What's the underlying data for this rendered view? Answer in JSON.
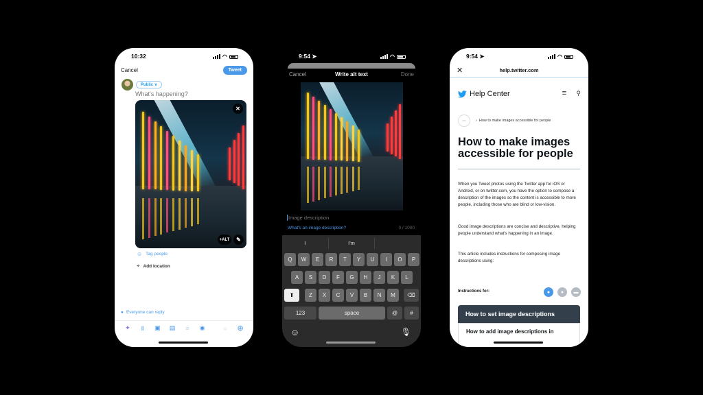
{
  "compose_screen": {
    "time": "10:32",
    "cancel_label": "Cancel",
    "tweet_label": "Tweet",
    "audience_label": "Public",
    "placeholder": "What's happening?",
    "image_close_icon": "close-icon",
    "alt_button_label": "+ALT",
    "edit_icon": "pencil-icon",
    "tag_people_label": "Tag people",
    "add_location_label": "Add location",
    "reply_setting_label": "Everyone can reply",
    "toolbar_icons": [
      "spaces-icon",
      "audio-icon",
      "image-icon",
      "gif-icon",
      "poll-icon",
      "location-icon"
    ],
    "accent_color": "#4a99e9"
  },
  "alt_text_screen": {
    "time": "9:54",
    "cancel_label": "Cancel",
    "title": "Write alt text",
    "done_label": "Done",
    "input_placeholder": "Image description",
    "help_link": "What's an image description?",
    "char_count": "0 / 1000",
    "suggestions": [
      "I",
      "I'm",
      ""
    ],
    "keyboard_rows": [
      [
        "Q",
        "W",
        "E",
        "R",
        "T",
        "Y",
        "U",
        "I",
        "O",
        "P"
      ],
      [
        "A",
        "S",
        "D",
        "F",
        "G",
        "H",
        "J",
        "K",
        "L"
      ],
      [
        "Z",
        "X",
        "C",
        "V",
        "B",
        "N",
        "M"
      ]
    ],
    "numbers_key": "123",
    "space_key": "space",
    "at_key": "@",
    "hash_key": "#"
  },
  "help_screen": {
    "time": "9:54",
    "url": "help.twitter.com",
    "brand_label": "Help Center",
    "breadcrumb": "How to make images accessible for people",
    "title": "How to make images accessible for people",
    "paragraphs": [
      "When you Tweet photos using the Twitter app for iOS or Android, or on twitter.com, you have the option to compose a description of the images so the content is accessible to more people, including those who are blind or low-vision.",
      "Good image descriptions are concise and descriptive, helping people understand what's happening in an image.",
      "This article includes instructions for composing image descriptions using:"
    ],
    "instructions_label": "Instructions for:",
    "platforms": [
      "ios",
      "android",
      "web"
    ],
    "accordion_title": "How to set image descriptions",
    "accordion_sub": "How to add image descriptions in"
  }
}
